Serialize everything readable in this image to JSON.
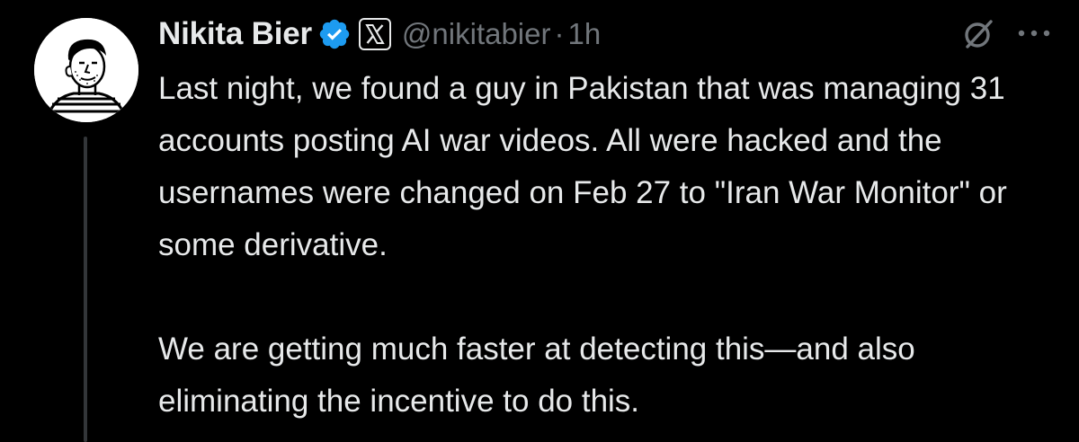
{
  "tweet": {
    "author": {
      "display_name": "Nikita Bier",
      "handle": "@nikitabier",
      "verified": true,
      "affiliate_badge": "x-logo-icon"
    },
    "separator": "·",
    "time": "1h",
    "body": {
      "paragraph_1": "Last night, we found a guy in Pakistan that was managing 31 accounts posting AI war videos. All were hacked and the usernames were changed on Feb 27 to \"Iran War Monitor\" or some derivative.",
      "paragraph_2": "We are getting much faster at detecting this—and also eliminating the incentive to do this."
    },
    "icons": {
      "mute": "grok-slash-icon",
      "more": "more-options-icon"
    },
    "colors": {
      "background": "#000000",
      "text": "#e7e9ea",
      "secondary": "#71767b",
      "verified": "#1d9bf0",
      "thread_line": "#333639"
    }
  }
}
